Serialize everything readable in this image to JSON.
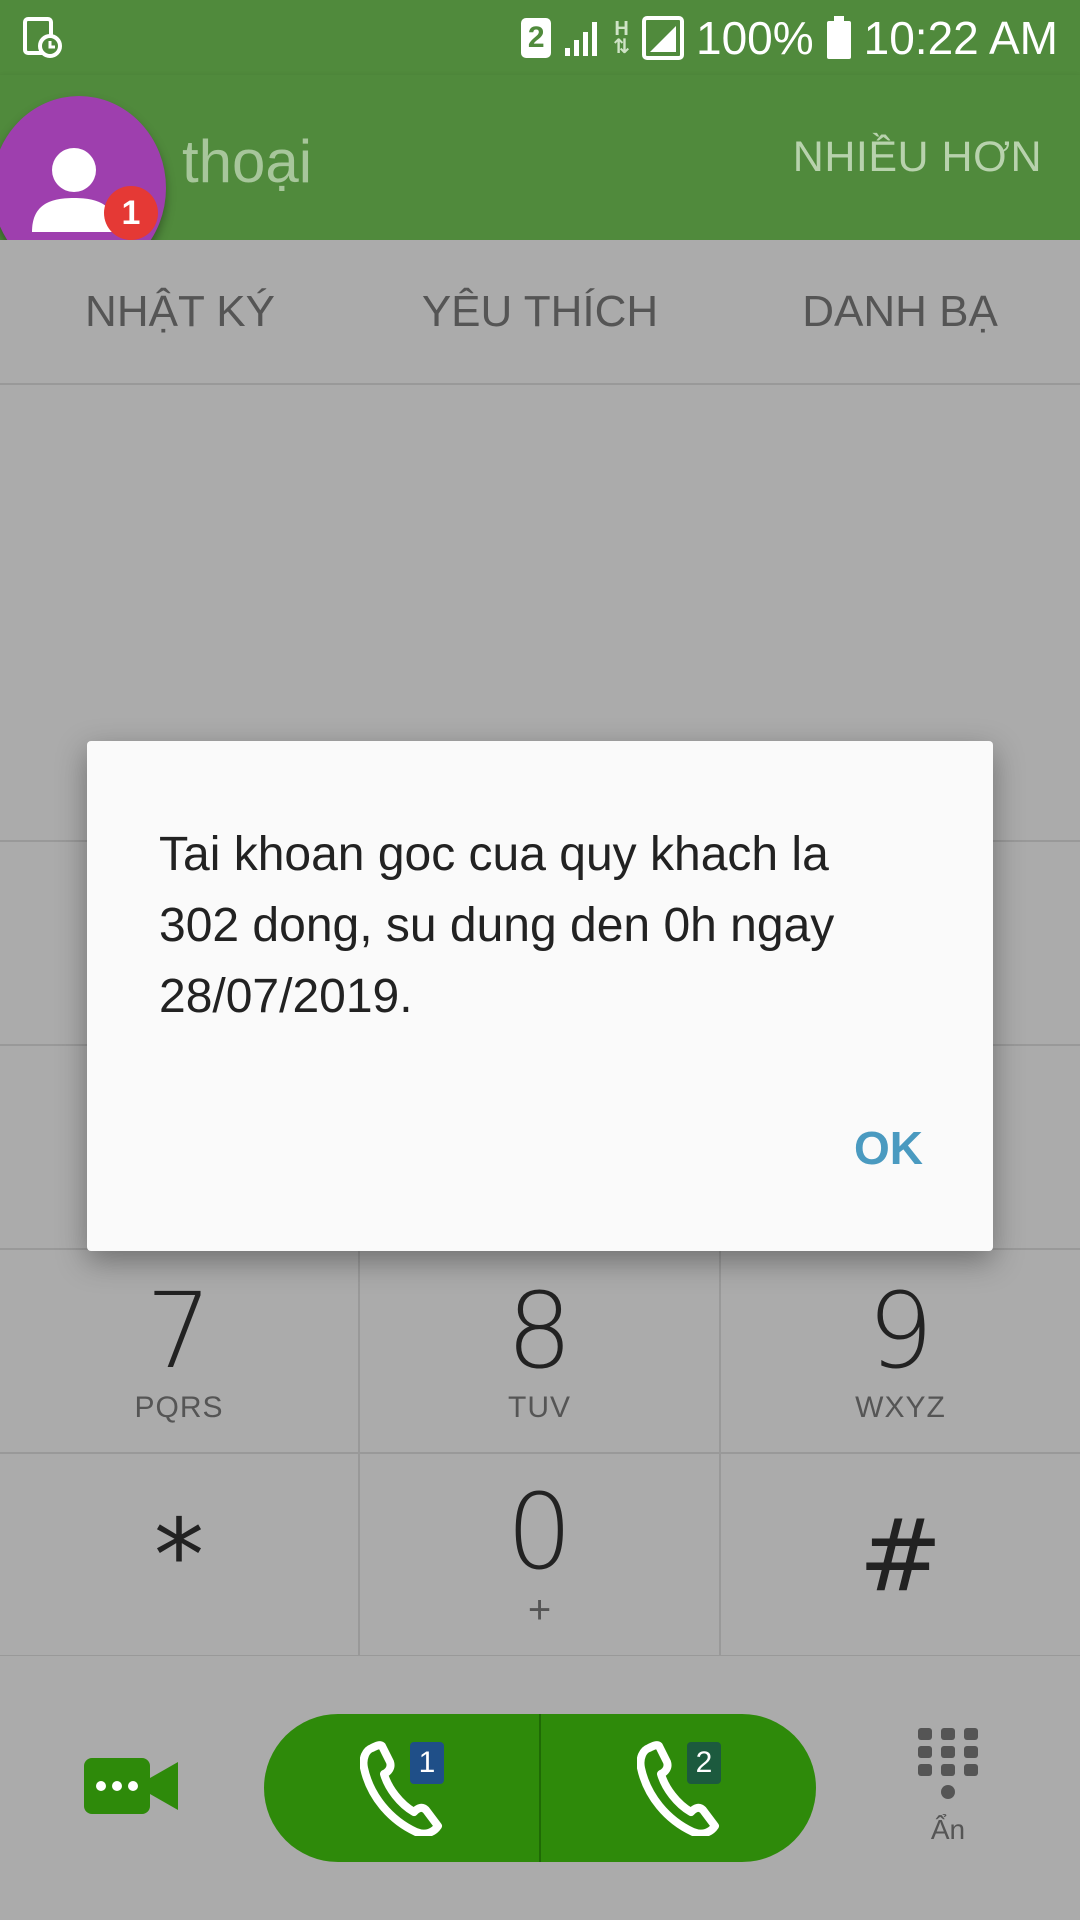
{
  "status_bar": {
    "battery": "100%",
    "time": "10:22 AM",
    "sim_indicator": "2",
    "network_type": "H"
  },
  "app_bar": {
    "title": "thoại",
    "more_label": "NHIỀU HƠN",
    "notification_count": "1"
  },
  "tabs": [
    "NHẬT KÝ",
    "YÊU THÍCH",
    "DANH BẠ"
  ],
  "keypad": [
    {
      "digit": "7",
      "letters": "PQRS"
    },
    {
      "digit": "8",
      "letters": "TUV"
    },
    {
      "digit": "9",
      "letters": "WXYZ"
    },
    {
      "digit": "*",
      "letters": ""
    },
    {
      "digit": "0",
      "letters": "+"
    },
    {
      "digit": "#",
      "letters": ""
    }
  ],
  "bottom_bar": {
    "sim1_label": "1",
    "sim2_label": "2",
    "hide_label": "Ẩn"
  },
  "dialog": {
    "message": "Tai khoan goc cua quy khach la 302 dong, su dung den 0h ngay 28/07/2019.",
    "ok_label": "OK"
  },
  "colors": {
    "header_green": "#508a3c",
    "call_green": "#2e8a0a",
    "avatar_purple": "#9e3fae",
    "badge_red": "#e53935",
    "dialog_button_blue": "#4a9ac0",
    "dim_overlay_gray": "#ababab"
  },
  "icons": [
    "alarm-icon",
    "sim2-icon",
    "signal-icon",
    "data-h-icon",
    "signal-full-icon",
    "battery-icon",
    "person-icon",
    "video-call-icon",
    "phone-icon",
    "dialpad-icon"
  ]
}
